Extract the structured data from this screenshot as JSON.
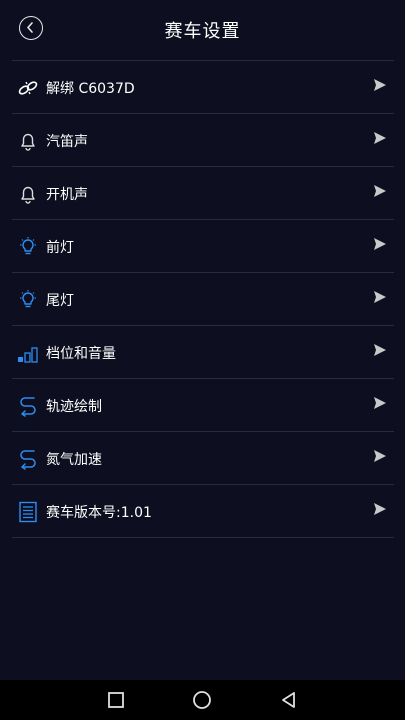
{
  "header": {
    "title": "赛车设置"
  },
  "items": [
    {
      "label": "解绑 C6037D",
      "icon": "link-icon"
    },
    {
      "label": "汽笛声",
      "icon": "bell-icon"
    },
    {
      "label": "开机声",
      "icon": "bell-icon"
    },
    {
      "label": "前灯",
      "icon": "lightbulb-icon"
    },
    {
      "label": "尾灯",
      "icon": "lightbulb-icon"
    },
    {
      "label": "档位和音量",
      "icon": "bars-icon"
    },
    {
      "label": "轨迹绘制",
      "icon": "path-icon"
    },
    {
      "label": "氮气加速",
      "icon": "path-icon"
    },
    {
      "label": "赛车版本号:1.01",
      "icon": "document-icon"
    }
  ],
  "colors": {
    "background": "#0d0e1f",
    "accent": "#2d8cf0",
    "divider": "#2a2c3d"
  }
}
